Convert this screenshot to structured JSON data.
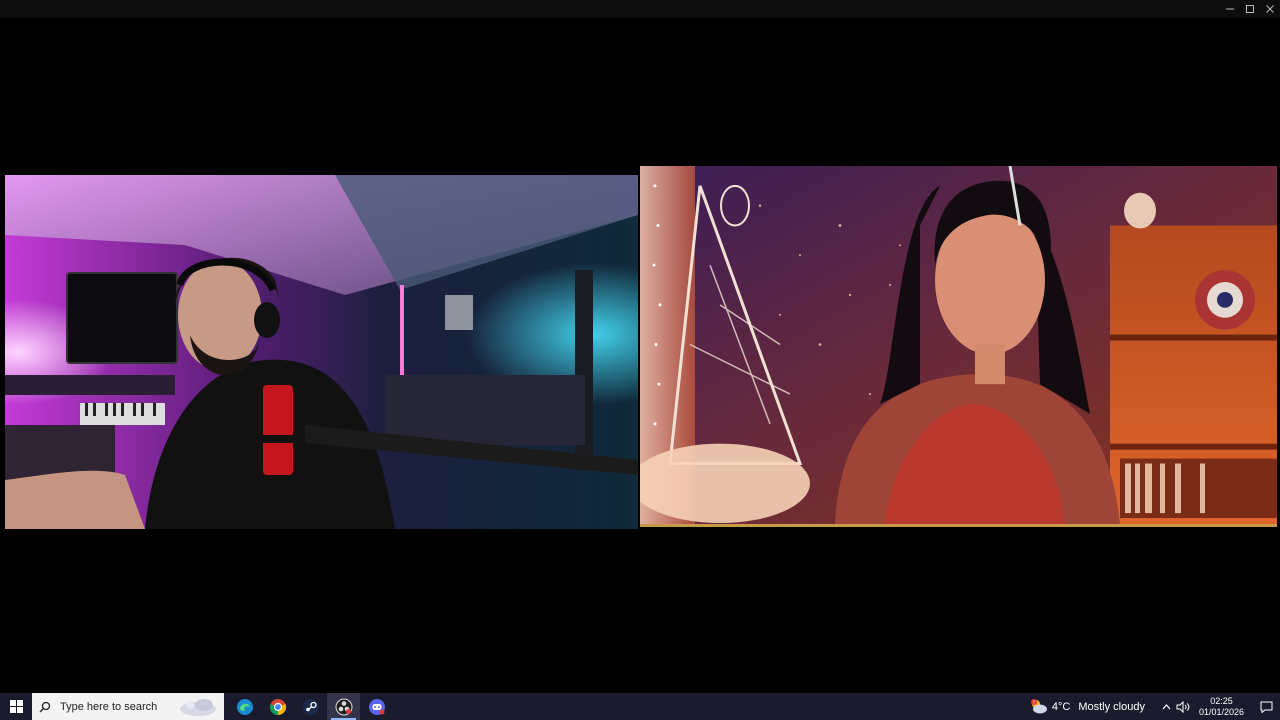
{
  "window": {
    "controls": {
      "minimize_icon": "minimize-icon",
      "maximize_icon": "maximize-icon",
      "close_icon": "close-icon"
    }
  },
  "call": {
    "participants": [
      {
        "id": "left",
        "scene": "man with beard and headphones at microphone, purple and cyan lit room"
      },
      {
        "id": "right",
        "scene": "woman with dark hair in red top, warm orange lit room with starry wall and shelves"
      }
    ],
    "active_border_color": "#c59a48"
  },
  "taskbar": {
    "start_icon": "windows-start-icon",
    "search": {
      "placeholder": "Type here to search"
    },
    "apps": [
      {
        "name": "edge",
        "icon": "edge-icon"
      },
      {
        "name": "chrome",
        "icon": "chrome-icon"
      },
      {
        "name": "steam",
        "icon": "steam-icon"
      },
      {
        "name": "obs",
        "icon": "obs-icon",
        "active": true
      },
      {
        "name": "discord",
        "icon": "discord-icon"
      }
    ],
    "weather": {
      "temp": "4°C",
      "condition": "Mostly cloudy",
      "alert_badge": "!"
    },
    "clock": {
      "time": "02:25",
      "date": "01/01/2026"
    },
    "colors": {
      "background": "#1b1b2e",
      "search_bg": "#f3f3f3"
    }
  }
}
